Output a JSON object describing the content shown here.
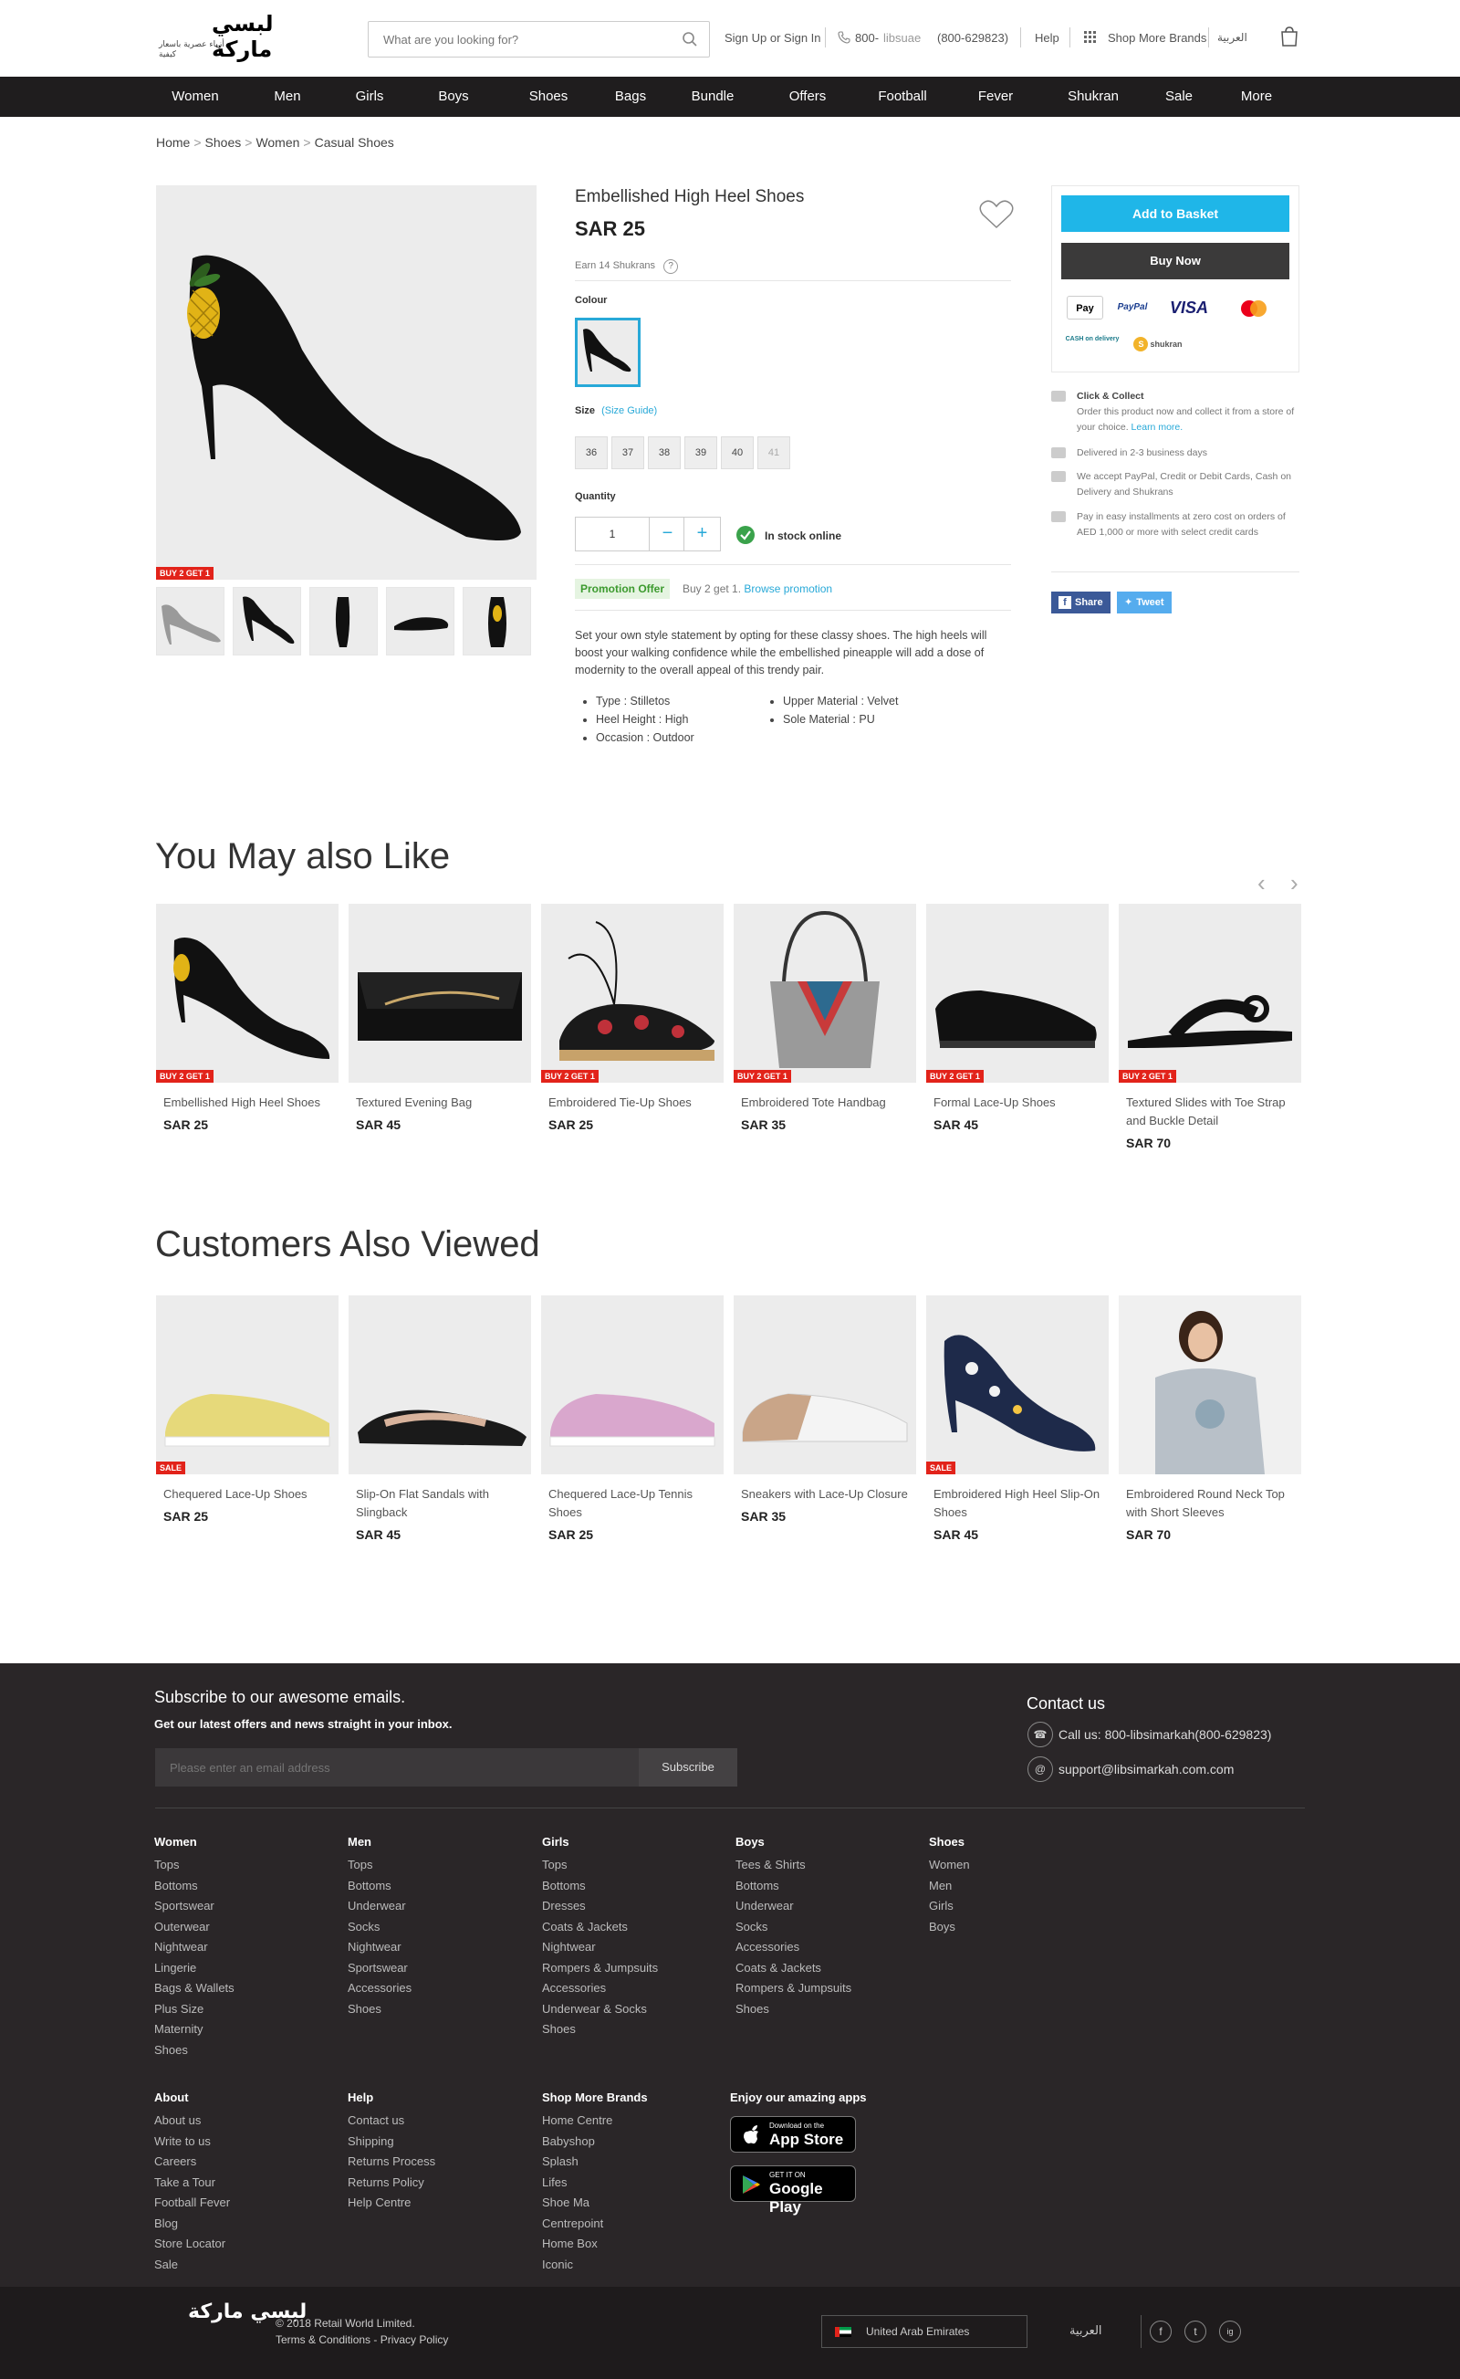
{
  "header": {
    "logo_text": "لبسي ماركة",
    "logo_sub": "أزياء عصرية باسعار كيفية",
    "search_placeholder": "What are you looking for?",
    "signin": "Sign Up or Sign In",
    "phone_prefix": "800-",
    "phone_word": "libsuae",
    "phone_number": "(800-629823)",
    "help": "Help",
    "shop_more": "Shop More Brands",
    "lang": "العربية"
  },
  "nav": [
    "Women",
    "Men",
    "Girls",
    "Boys",
    "Shoes",
    "Bags",
    "Bundle",
    "Offers",
    "Football",
    "Fever",
    "Shukran",
    "Sale",
    "More"
  ],
  "breadcrumb": [
    "Home",
    "Shoes",
    "Women",
    "Casual Shoes"
  ],
  "product": {
    "title": "Embellished High Heel Shoes",
    "price": "SAR 25",
    "earn": "Earn 14 Shukrans",
    "badge": "BUY 2 GET 1",
    "colour_label": "Colour",
    "size_label": "Size",
    "size_guide": "(Size Guide)",
    "sizes": [
      "36",
      "37",
      "38",
      "39",
      "40",
      "41"
    ],
    "quantity_label": "Quantity",
    "quantity": "1",
    "minus": "−",
    "plus": "+",
    "stock": "In stock online",
    "promo_tag": "Promotion Offer",
    "promo_text": "Buy 2 get 1.",
    "promo_link": "Browse promotion",
    "description": "Set your own style statement by opting for these classy shoes. The high heels will boost your walking confidence while the embellished pineapple will add a dose of modernity to the overall appeal of this trendy pair.",
    "specs_left": [
      "Type : Stilletos",
      "Heel Height : High",
      "Occasion : Outdoor"
    ],
    "specs_right": [
      "Upper Material : Velvet",
      "Sole Material : PU"
    ]
  },
  "buybox": {
    "add": "Add to Basket",
    "buy": "Buy Now",
    "applepay": "Pay",
    "paypal": "PayPal",
    "visa": "VISA",
    "cod": "CASH on delivery",
    "shukran": "shukran"
  },
  "info": {
    "cc_title": "Click & Collect",
    "cc_text": "Order this product now and collect it from a store of your choice.",
    "cc_link": "Learn more.",
    "delivery": "Delivered in 2-3 business days",
    "accept": "We accept PayPal, Credit or Debit Cards, Cash on Delivery and Shukrans",
    "install": "Pay in easy installments at zero cost on orders of AED 1,000 or more with select credit cards",
    "share": "Share",
    "tweet": "Tweet"
  },
  "may_like": {
    "title": "You May also Like",
    "items": [
      {
        "name": "Embellished High Heel Shoes",
        "price": "SAR 25",
        "badge": "BUY 2 GET 1"
      },
      {
        "name": "Textured Evening Bag",
        "price": "SAR 45",
        "badge": ""
      },
      {
        "name": "Embroidered Tie-Up Shoes",
        "price": "SAR 25",
        "badge": "BUY 2 GET 1"
      },
      {
        "name": "Embroidered Tote Handbag",
        "price": "SAR 35",
        "badge": "BUY 2 GET 1"
      },
      {
        "name": "Formal Lace-Up Shoes",
        "price": "SAR 45",
        "badge": "BUY 2 GET 1"
      },
      {
        "name": "Textured Slides with Toe Strap and Buckle Detail",
        "price": "SAR 70",
        "badge": "BUY 2 GET 1"
      }
    ]
  },
  "also_viewed": {
    "title": "Customers Also Viewed",
    "items": [
      {
        "name": "Chequered Lace-Up Shoes",
        "price": "SAR 25",
        "badge": "SALE"
      },
      {
        "name": "Slip-On Flat Sandals with Slingback",
        "price": "SAR 45",
        "badge": ""
      },
      {
        "name": "Chequered Lace-Up Tennis Shoes",
        "price": "SAR 25",
        "badge": ""
      },
      {
        "name": "Sneakers with Lace-Up Closure",
        "price": "SAR 35",
        "badge": ""
      },
      {
        "name": "Embroidered High Heel Slip-On Shoes",
        "price": "SAR 45",
        "badge": "SALE"
      },
      {
        "name": "Embroidered Round Neck Top with Short Sleeves",
        "price": "SAR 70",
        "badge": ""
      }
    ]
  },
  "footer": {
    "subscribe_title": "Subscribe to our awesome emails.",
    "subscribe_sub": "Get our latest offers and news straight in your inbox.",
    "email_placeholder": "Please enter an email address",
    "subscribe_btn": "Subscribe",
    "contact_title": "Contact us",
    "call": "Call us: 800-libsimarkah(800-629823)",
    "email": "support@libsimarkah.com.com",
    "cols": [
      {
        "title": "Women",
        "items": [
          "Tops",
          "Bottoms",
          "Sportswear",
          "Outerwear",
          "Nightwear",
          "Lingerie",
          "Bags & Wallets",
          "Plus Size",
          "Maternity",
          "Shoes"
        ]
      },
      {
        "title": "Men",
        "items": [
          "Tops",
          "Bottoms",
          "Underwear",
          "Socks",
          "Nightwear",
          "Sportswear",
          "Accessories",
          "Shoes"
        ]
      },
      {
        "title": "Girls",
        "items": [
          "Tops",
          "Bottoms",
          "Dresses",
          "Coats & Jackets",
          "Nightwear",
          "Rompers & Jumpsuits",
          "Accessories",
          "Underwear & Socks",
          "Shoes"
        ]
      },
      {
        "title": "Boys",
        "items": [
          "Tees & Shirts",
          "Bottoms",
          "Underwear",
          "Socks",
          "Accessories",
          "Coats & Jackets",
          "Rompers & Jumpsuits",
          "Shoes"
        ]
      },
      {
        "title": "Shoes",
        "items": [
          "Women",
          "Men",
          "Girls",
          "Boys"
        ]
      }
    ],
    "cols2": [
      {
        "title": "About",
        "items": [
          "About us",
          "Write to us",
          "Careers",
          "Take a Tour",
          "Football Fever",
          "Blog",
          "Store Locator",
          "Sale"
        ]
      },
      {
        "title": "Help",
        "items": [
          "Contact us",
          "Shipping",
          "Returns Process",
          "Returns Policy",
          "Help Centre"
        ]
      },
      {
        "title": "Shop More Brands",
        "items": [
          "Home Centre",
          "Babyshop",
          "Splash",
          "Lifes",
          "Shoe Ma",
          "Centrepoint",
          "Home Box",
          "Iconic"
        ]
      }
    ],
    "apps_title": "Enjoy our amazing apps",
    "appstore_small": "Download on the",
    "appstore": "App Store",
    "gplay_small": "GET IT ON",
    "gplay": "Google Play",
    "copyright": "© 2018 Retail World Limited.",
    "terms": "Terms & Conditions - Privacy Policy",
    "country": "United Arab Emirates",
    "lang": "العربية",
    "social": [
      "f",
      "t",
      "ig"
    ]
  }
}
